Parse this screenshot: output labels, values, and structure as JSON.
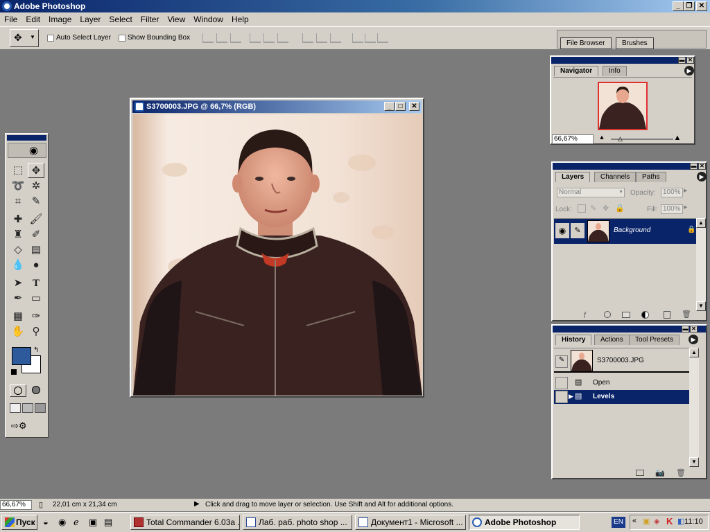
{
  "app": {
    "title": "Adobe Photoshop"
  },
  "menu": [
    "File",
    "Edit",
    "Image",
    "Layer",
    "Select",
    "Filter",
    "View",
    "Window",
    "Help"
  ],
  "options": {
    "auto_select": "Auto Select Layer",
    "bounding_box": "Show Bounding Box",
    "file_browser": "File Browser",
    "brushes": "Brushes"
  },
  "document": {
    "title": "S3700003.JPG @ 66,7% (RGB)"
  },
  "navigator": {
    "tabs": [
      "Navigator",
      "Info"
    ],
    "zoom": "66,67%"
  },
  "layers": {
    "tabs": [
      "Layers",
      "Channels",
      "Paths"
    ],
    "blend_mode": "Normal",
    "opacity_label": "Opacity:",
    "opacity": "100%",
    "lock_label": "Lock:",
    "fill_label": "Fill:",
    "fill": "100%",
    "layer_name": "Background"
  },
  "history": {
    "tabs": [
      "History",
      "Actions",
      "Tool Presets"
    ],
    "snapshot": "S3700003.JPG",
    "states": [
      "Open",
      "Levels"
    ]
  },
  "statusbar": {
    "zoom": "66,67%",
    "size": "22,01 cm x 21,34 cm",
    "message": "Click and drag to move layer or selection.  Use Shift and Alt for additional options."
  },
  "taskbar": {
    "start": "Пуск",
    "items": [
      "Total Commander 6.03a ...",
      "Лаб. раб. photo shop ...",
      "Документ1 - Microsoft ...",
      "Adobe Photoshop"
    ],
    "lang": "EN",
    "clock": "11:10"
  },
  "colors": {
    "foreground": "#2e5a9c",
    "background": "#ffffff",
    "selection": "#0a246a"
  }
}
